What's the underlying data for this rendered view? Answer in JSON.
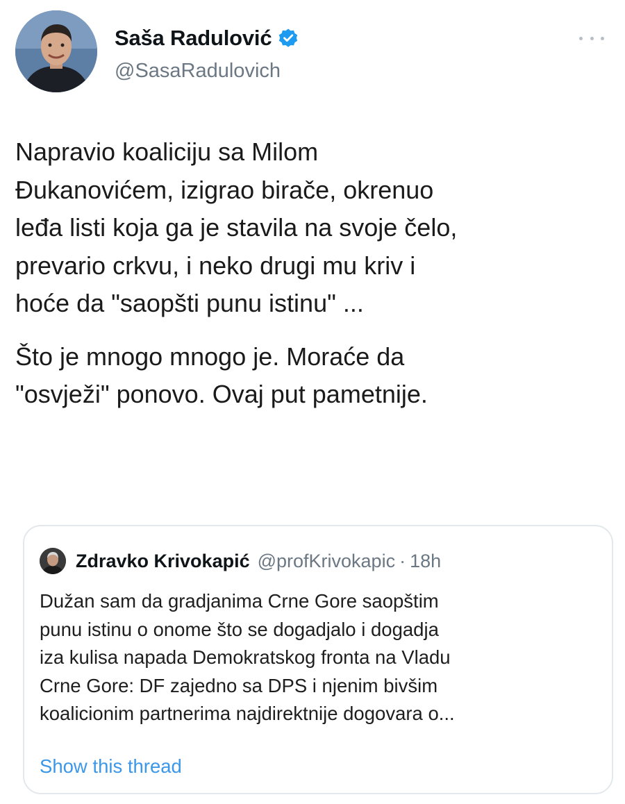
{
  "tweet": {
    "author": {
      "display_name": "Saša Radulović",
      "handle": "@SasaRadulovich",
      "verified": true,
      "avatar_icon": "profile-photo"
    },
    "more_icon": "ellipsis-icon",
    "paragraphs": [
      {
        "lines": [
          "Napravio koaliciju sa Milom",
          "Đukanovićem, izigrao birače,  okrenuo",
          "leđa listi koja ga je stavila na svoje čelo,",
          "prevario crkvu, i neko drugi mu kriv i",
          "hoće da \"saopšti punu istinu\" ..."
        ]
      },
      {
        "lines": [
          "Što je mnogo mnogo je. Moraće da",
          "\"osvježi\" ponovo. Ovaj put pametnije."
        ]
      }
    ],
    "quoted_tweet": {
      "author_name": "Zdravko Krivokapić",
      "author_handle": "@profKrivokapic",
      "separator": "·",
      "time": "18h",
      "lines": [
        "Dužan sam da gradjanima Crne Gore saopštim",
        "punu istinu o onome što se dogadjalo i dogadja",
        "iza kulisa napada Demokratskog fronta na Vladu",
        "Crne Gore: DF zajedno sa DPS i njenim bivšim",
        "koalicionim partnerima najdirektnije dogovara o..."
      ],
      "show_thread_label": "Show this thread"
    }
  },
  "colors": {
    "verified_badge": "#1d9bf0",
    "link": "#3b97e8",
    "secondary_text": "#6b7884",
    "card_border": "#e3e8ec"
  }
}
